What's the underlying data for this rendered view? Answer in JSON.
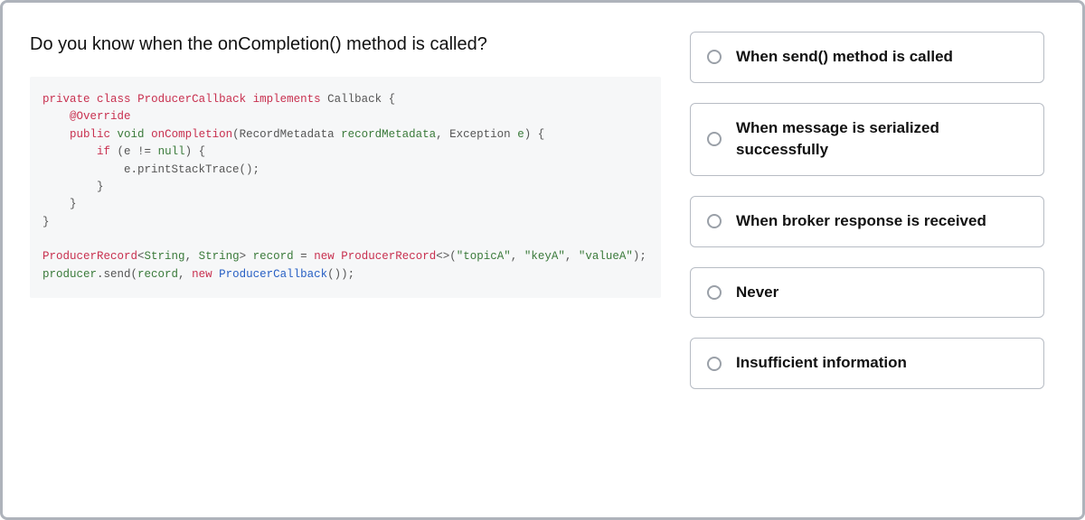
{
  "question": "Do you know when the onCompletion() method is called?",
  "code": {
    "l1a": "private",
    "l1b": "class",
    "l1c": "ProducerCallback",
    "l1d": "implements",
    "l1e": "Callback {",
    "l2a": "@Override",
    "l3a": "public",
    "l3b": "void",
    "l3c": "onCompletion",
    "l3d": "(RecordMetadata",
    "l3e": "recordMetadata",
    "l3f": ", Exception",
    "l3g": "e",
    "l3h": ") {",
    "l4a": "if",
    "l4b": "(e !=",
    "l4c": "null",
    "l4d": ") {",
    "l5a": "e.printStackTrace();",
    "l6": "}",
    "l7": "}",
    "l8": "}",
    "l9a": "ProducerRecord",
    "l9b": "<",
    "l9c": "String",
    "l9d": ",",
    "l9e": "String",
    "l9f": ">",
    "l9g": "record",
    "l9h": "=",
    "l9i": "new",
    "l9j": "ProducerRecord",
    "l9k": "<>(",
    "l9l": "\"topicA\"",
    "l9m": ",",
    "l9n": "\"keyA\"",
    "l9o": ",",
    "l9p": "\"valueA\"",
    "l9q": ");",
    "l10a": "producer",
    "l10b": ".send(",
    "l10c": "record",
    "l10d": ",",
    "l10e": "new",
    "l10f": "ProducerCallback",
    "l10g": "());"
  },
  "options": [
    {
      "label": "When send() method is called"
    },
    {
      "label": "When message is serialized successfully"
    },
    {
      "label": "When broker response is received"
    },
    {
      "label": "Never"
    },
    {
      "label": "Insufficient information"
    }
  ]
}
